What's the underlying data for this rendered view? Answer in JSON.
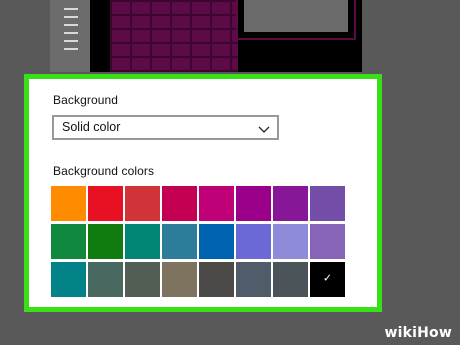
{
  "background_section": {
    "label": "Background",
    "dropdown_value": "Solid color"
  },
  "colors_section": {
    "label": "Background colors",
    "selected_index": 23,
    "swatches": [
      "#ff8c00",
      "#e81123",
      "#d13438",
      "#c30052",
      "#bf0077",
      "#9a0089",
      "#881798",
      "#744da9",
      "#10893e",
      "#107c10",
      "#018574",
      "#2d7d9a",
      "#0063b1",
      "#6b69d6",
      "#8e8cd8",
      "#8764b8",
      "#038387",
      "#486860",
      "#525e54",
      "#7e735f",
      "#4c4a48",
      "#515c6b",
      "#4a5459",
      "#000000"
    ],
    "check_glyph": "✓"
  },
  "highlight_color": "#39e018",
  "watermark": {
    "text": "wikiHow"
  }
}
